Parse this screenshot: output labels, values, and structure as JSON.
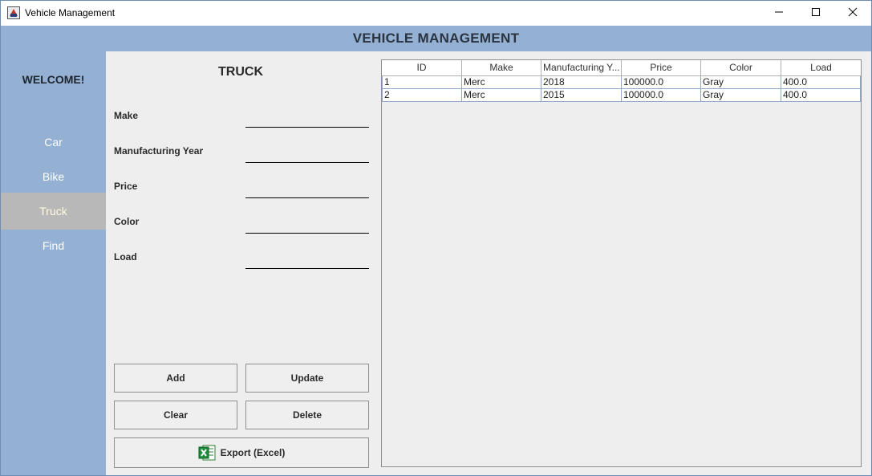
{
  "window": {
    "title": "Vehicle Management"
  },
  "header": {
    "title": "VEHICLE MANAGEMENT"
  },
  "sidebar": {
    "welcome": "WELCOME!",
    "items": [
      {
        "label": "Car",
        "active": false
      },
      {
        "label": "Bike",
        "active": false
      },
      {
        "label": "Truck",
        "active": true
      },
      {
        "label": "Find",
        "active": false
      }
    ]
  },
  "form": {
    "title": "TRUCK",
    "fields": [
      {
        "label": "Make",
        "value": ""
      },
      {
        "label": "Manufacturing Year",
        "value": ""
      },
      {
        "label": "Price",
        "value": ""
      },
      {
        "label": "Color",
        "value": ""
      },
      {
        "label": "Load",
        "value": ""
      }
    ],
    "buttons": {
      "add": "Add",
      "update": "Update",
      "clear": "Clear",
      "delete": "Delete",
      "export": "Export (Excel)"
    }
  },
  "table": {
    "columns": [
      "ID",
      "Make",
      "Manufacturing Y...",
      "Price",
      "Color",
      "Load"
    ],
    "rows": [
      [
        "1",
        "Merc",
        "2018",
        "100000.0",
        "Gray",
        "400.0"
      ],
      [
        "2",
        "Merc",
        "2015",
        "100000.0",
        "Gray",
        "400.0"
      ]
    ]
  },
  "colors": {
    "sidebar_bg": "#94b0d2",
    "active_item_bg": "#b8b8b8",
    "panel_bg": "#eeeeee"
  }
}
